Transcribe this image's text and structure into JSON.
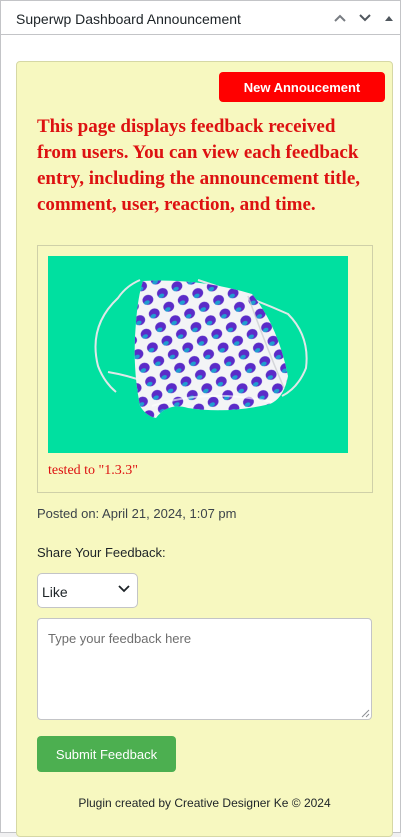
{
  "widget": {
    "title": "Superwp Dashboard Announcement",
    "controls": {
      "move_up_icon": "chevron-up-icon",
      "move_down_icon": "chevron-down-icon",
      "toggle_icon": "caret-up-icon"
    }
  },
  "announcement": {
    "new_button_label": "New Annoucement",
    "description": "This page displays feedback received from users. You can view each feedback entry, including the announcement title, comment, user, reaction, and time.",
    "tested_text": "tested to \"1.3.3\"",
    "posted_on": "Posted on: April 21, 2024, 1:07 pm"
  },
  "feedback": {
    "label": "Share Your Feedback:",
    "reaction_selected": "Like",
    "placeholder": "Type your feedback here",
    "submit_label": "Submit Feedback"
  },
  "footer": {
    "text": "Plugin created by Creative Designer Ke © 2024"
  },
  "colors": {
    "panel_background": "#f7f8c0",
    "new_button": "#ff0000",
    "description_text": "#dd1111",
    "submit_button": "#4caf50",
    "image_background": "#00e0a0",
    "bag_dots": "#5b2bc8"
  }
}
